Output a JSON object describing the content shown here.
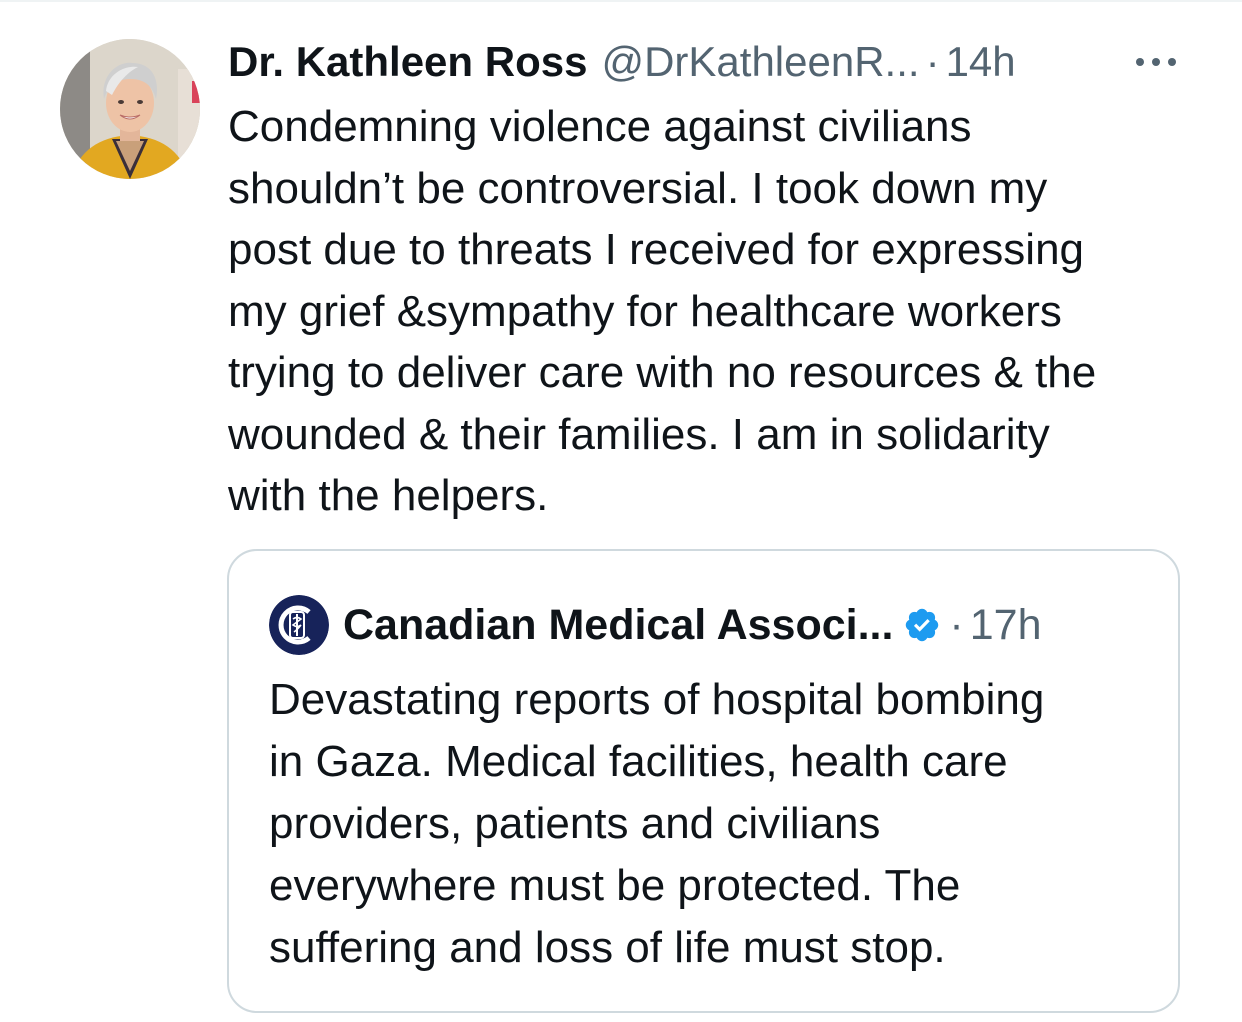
{
  "tweet": {
    "author": {
      "display_name": "Dr. Kathleen Ross",
      "handle": "@DrKathleenR...",
      "avatar_alt": "avatar"
    },
    "separator": "·",
    "timestamp": "14h",
    "more_icon": "more-horizontal-icon",
    "text": "Condemning violence against civilians\nshouldn’t be controversial. I took down my\npost due to threats I received for expressing\nmy grief &sympathy for healthcare workers\ntrying to deliver care with no resources & the\nwounded & their families.  I am in solidarity\nwith the helpers."
  },
  "quoted_tweet": {
    "author": {
      "display_name": "Canadian Medical Associ...",
      "logo_icon": "caduceus-logo-icon",
      "verified_icon": "verified-badge-icon"
    },
    "separator": "·",
    "timestamp": "17h",
    "text": "Devastating reports of hospital bombing\nin Gaza. Medical facilities, health care\nproviders, patients and civilians\neverywhere must be protected. The\nsuffering and loss of life must stop."
  },
  "colors": {
    "text_primary": "#0f1419",
    "text_secondary": "#536471",
    "border": "#cfd9de",
    "verified_blue": "#1d9bf0",
    "logo_navy": "#17235a"
  }
}
